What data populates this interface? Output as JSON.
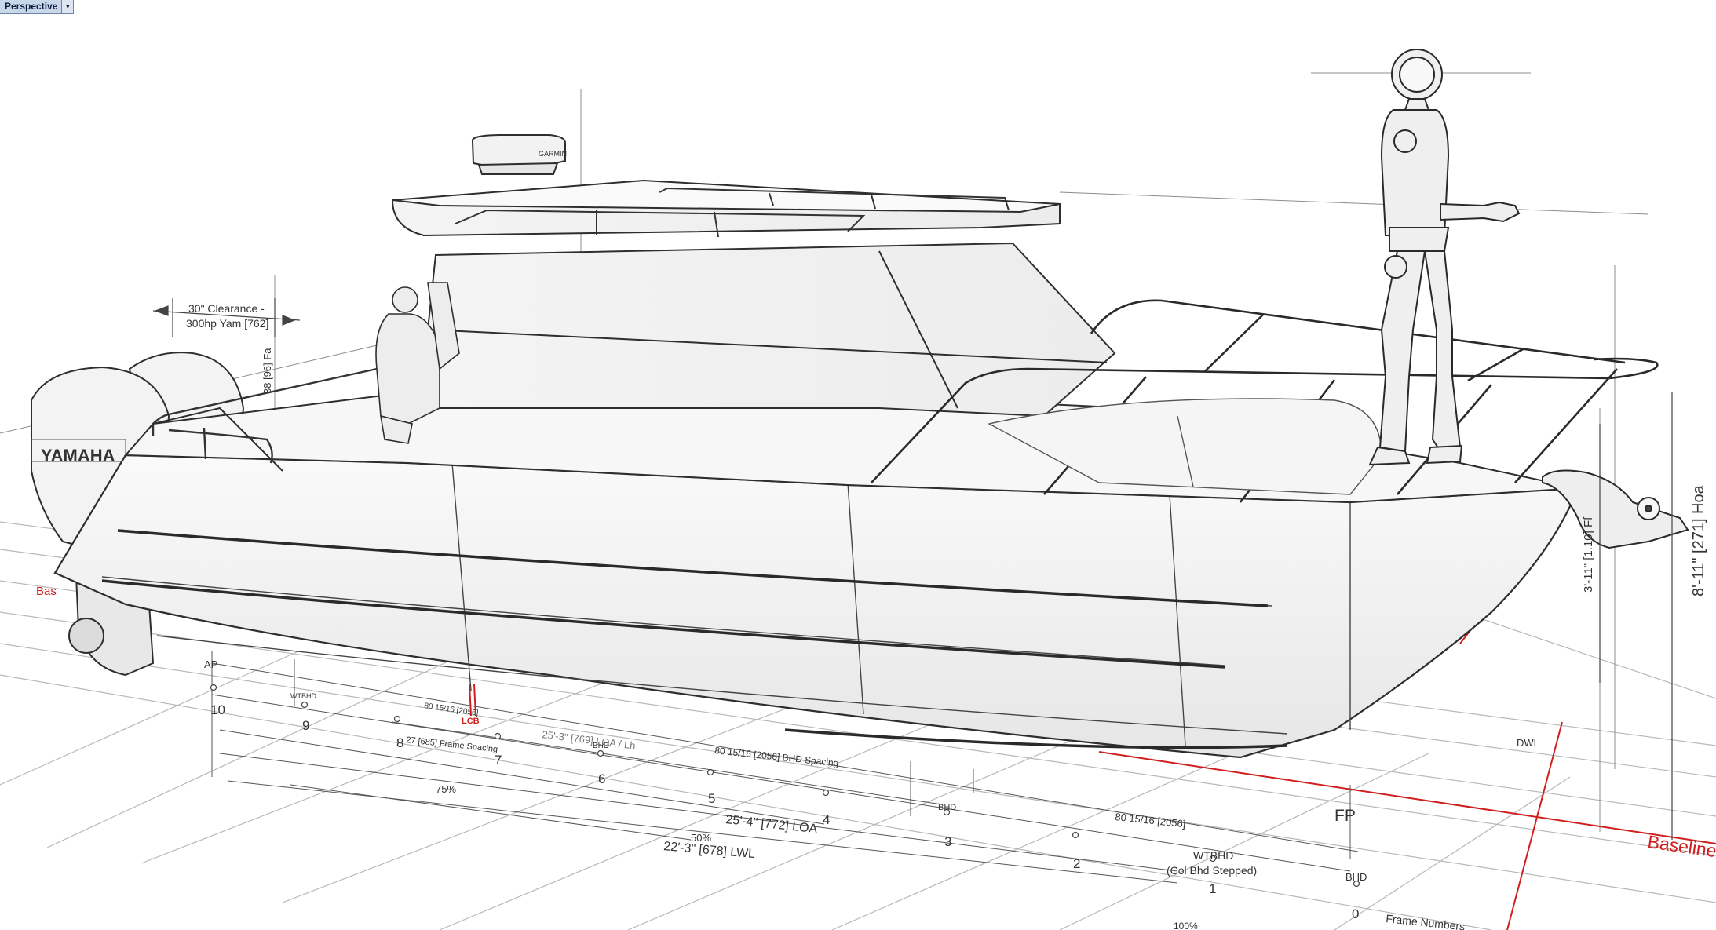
{
  "viewport": {
    "name": "Perspective",
    "menu_icon": "chevron-down-icon"
  },
  "annotations": {
    "clearance_line1": "30\" Clearance -",
    "clearance_line2": "300hp Yam [762]",
    "fa_dim": "38 [96] Fa",
    "ff_dim": "3'-11\" [1.10] Ff",
    "hoa_dim": "8'-11\" [271] Hoa",
    "baseline": "Baseline",
    "baseline_left": "Bas",
    "dwl": "DWL",
    "ap": "AP",
    "fp": "FP",
    "wtbhd_aft": "WTBHD",
    "lcb": "LCB",
    "bhd_mid": "BHD",
    "bhd_mid2": "BHD",
    "bhd_fwd": "BHD",
    "spacing_aft": "80 15/16 [2056]",
    "frame_spacing": "27 [685] Frame Spacing",
    "bhd_spacing": "80 15/16 [2056] BHD Spacing",
    "spacing_fwd": "80 15/16 [2056]",
    "lcb_pos": "25'-3\" [769] LOA / Lh",
    "loa": "25'-4\" [772] LOA",
    "lwl": "22'-3\" [678] LWL",
    "pct75": "75%",
    "pct50": "50%",
    "wtbhd_fwd_line1": "WTBHD",
    "wtbhd_fwd_line2": "(Col Bhd Stepped)",
    "frame_numbers": "Frame Numbers",
    "pct100": "100%",
    "engine_brand": "YAMAHA",
    "radar_brand": "GARMIN"
  },
  "frames": [
    "10",
    "9",
    "8",
    "7",
    "6",
    "5",
    "4",
    "3",
    "2",
    "1",
    "0"
  ],
  "colors": {
    "line": "#3a3a3a",
    "light_line": "#9a9a9a",
    "accent_red": "#d01f1f",
    "viewport_tab": "#c9d7ea"
  }
}
